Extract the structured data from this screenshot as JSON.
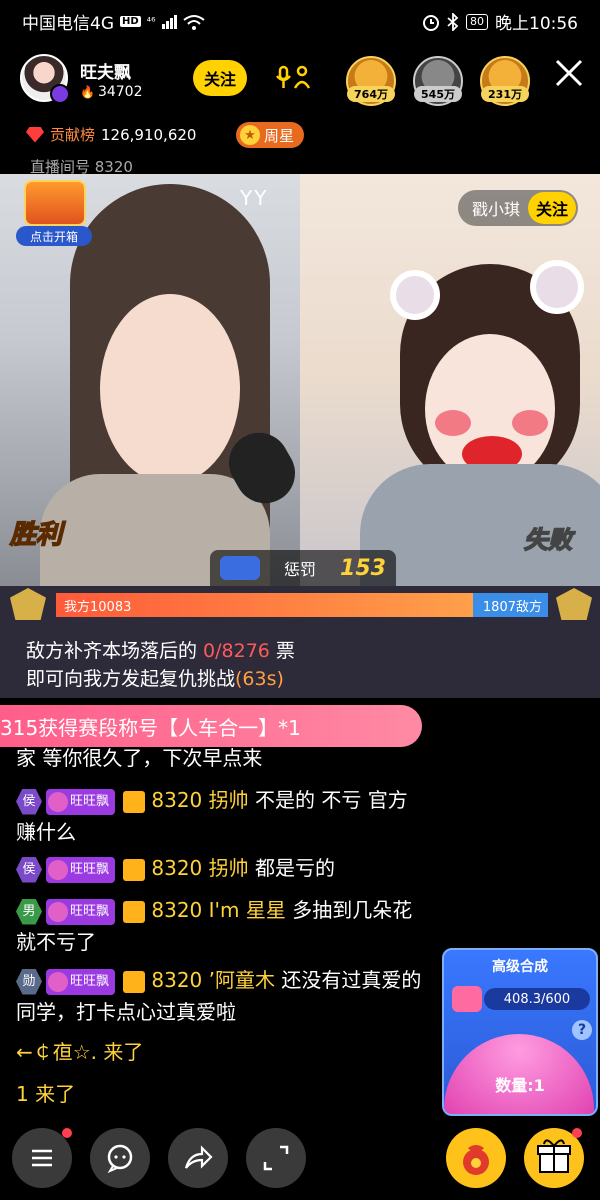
{
  "status": {
    "carrier": "中国电信4G",
    "hd": "HD",
    "net": "⁴⁶",
    "battery": "80",
    "time": "晚上10:56"
  },
  "host": {
    "name": "旺夫飘",
    "fans": "34702",
    "follow": "关注"
  },
  "viewers": [
    {
      "count": "764万"
    },
    {
      "count": "545万"
    },
    {
      "count": "231万"
    }
  ],
  "contrib": {
    "label": "贡献榜",
    "value": "126,910,620",
    "week": "周星"
  },
  "room": {
    "id": "直播间号 8320"
  },
  "video": {
    "box_label": "点击开箱",
    "yy": "YY",
    "opp_name": "戳小琪",
    "opp_follow": "关注",
    "win": "胜利",
    "lose": "失败"
  },
  "punish": {
    "label": "惩罚",
    "timer": "153"
  },
  "pk": {
    "ours": "我方10083",
    "theirs": "1807敌方",
    "ours_share": 0.847,
    "msg1_pre": "敌方补齐本场落后的 ",
    "msg1_frac": "0/8276",
    "msg1_post": " 票",
    "msg2_pre": "即可向我方发起复仇挑战",
    "msg2_time": "(63s)"
  },
  "toast": "315获得赛段称号【人车合一】*1",
  "chat": [
    {
      "text": "家  等你很久了，下次早点来"
    },
    {
      "rank": "侯",
      "fan": "旺旺飘",
      "uid": "8320",
      "user": "拐帅",
      "msg": "不是的 不亏 官方赚什么"
    },
    {
      "rank": "侯",
      "fan": "旺旺飘",
      "uid": "8320",
      "user": "拐帅",
      "msg": "都是亏的"
    },
    {
      "rank": "男",
      "fan": "旺旺飘",
      "uid": "8320",
      "user": "I'm 星星",
      "msg": "多抽到几朵花就不亏了"
    },
    {
      "rank": "勋",
      "fan": "旺旺飘",
      "uid": "8320",
      "user": "’阿童木",
      "msg": "还没有过真爱的同学，打卡点心过真爱啦"
    },
    {
      "join1": "←￠亱☆. 来了"
    },
    {
      "join2": "1 来了"
    }
  ],
  "synth": {
    "title": "高级合成",
    "progress": "408.3/600",
    "qty": "数量:1",
    "help": "?"
  },
  "icons": [
    "menu-icon",
    "chat-icon",
    "share-icon",
    "fullscreen-icon",
    "lucky-bag-icon",
    "gift-icon"
  ]
}
